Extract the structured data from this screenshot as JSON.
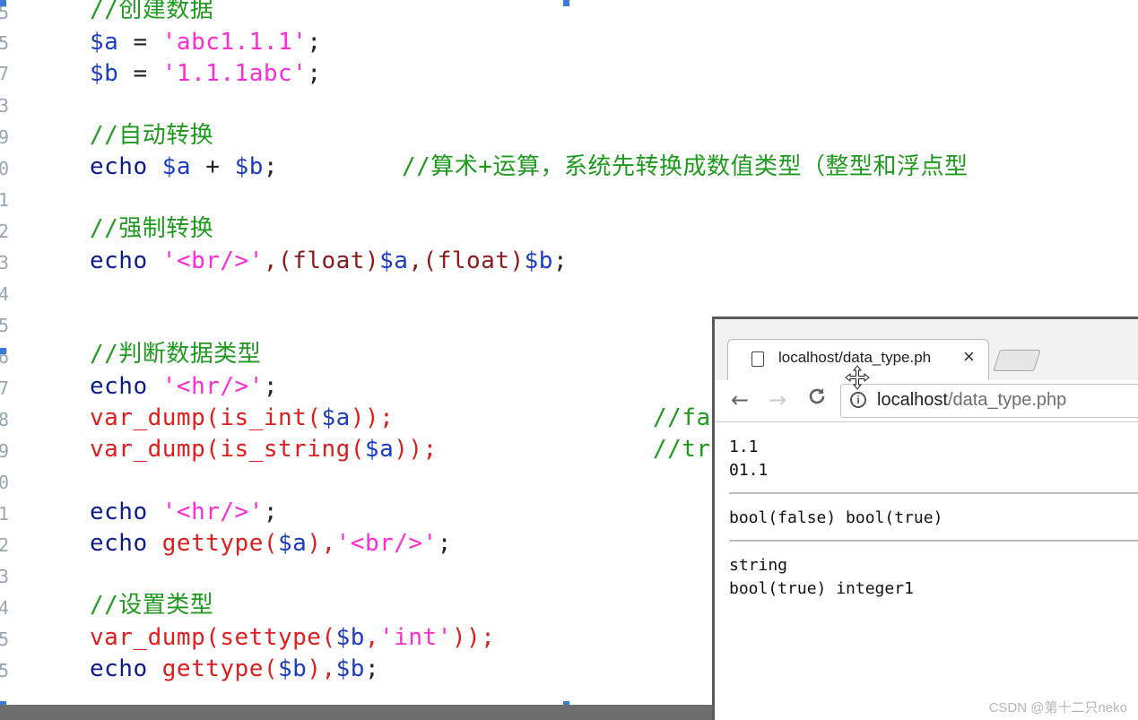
{
  "editor": {
    "line_numbers": [
      "5",
      "5",
      "7",
      "3",
      "9",
      "0",
      "1",
      "2",
      "3",
      "4",
      "5",
      "6",
      "7",
      "8",
      "9",
      "0",
      "1",
      "2",
      "3",
      "4",
      "5",
      "5"
    ],
    "line1_comment": "//创建数据",
    "line2_var": "$a",
    "line2_op": " = ",
    "line2_str": "'abc1.1.1'",
    "line2_end": ";",
    "line3_var": "$b",
    "line3_op": " = ",
    "line3_str": "'1.1.1abc'",
    "line3_end": ";",
    "line5_comment": "//自动转换",
    "line6_kw": "echo ",
    "line6_var1": "$a",
    "line6_op": " + ",
    "line6_var2": "$b",
    "line6_end": ";",
    "line6_comment": "//算术+运算，系统先转换成数值类型（整型和浮点型",
    "line8_comment": "//强制转换",
    "line9_kw": "echo ",
    "line9_str": "'<br/>'",
    "line9_c1": ",(float)",
    "line9_var1": "$a",
    "line9_c2": ",(float)",
    "line9_var2": "$b",
    "line9_end": ";",
    "line12_comment": "//判断数据类型",
    "line13_kw": "echo ",
    "line13_str": "'<hr/>'",
    "line13_end": ";",
    "line14_fn": "var_dump(is_int(",
    "line14_var": "$a",
    "line14_end": "));",
    "line14_comment": "//fa",
    "line15_fn": "var_dump(is_string(",
    "line15_var": "$a",
    "line15_end": "));",
    "line15_comment": "//tr",
    "line17_kw": "echo ",
    "line17_str": "'<hr/>'",
    "line17_end": ";",
    "line18_kw": "echo ",
    "line18_fn": "gettype(",
    "line18_var": "$a",
    "line18_c": "),",
    "line18_str": "'<br/>'",
    "line18_end": ";",
    "line20_comment": "//设置类型",
    "line21_fn": "var_dump(settype(",
    "line21_var": "$b",
    "line21_c": ",",
    "line21_str": "'int'",
    "line21_end": "));",
    "line22_kw": "echo ",
    "line22_fn": "gettype(",
    "line22_var": "$b",
    "line22_c": "),",
    "line22_var2": "$b",
    "line22_end": ";"
  },
  "browser": {
    "tab_title": "localhost/data_type.ph",
    "tab_close": "×",
    "back_icon": "←",
    "forward_icon": "→",
    "reload_icon": "C",
    "info_icon": "i",
    "url_host": "localhost",
    "url_path": "/data_type.php",
    "output": {
      "line1": "1.1",
      "line2": "01.1",
      "line3": "bool(false) bool(true)",
      "line4": "string",
      "line5": "bool(true) integer1"
    }
  },
  "watermark": "CSDN @第十二只neko"
}
